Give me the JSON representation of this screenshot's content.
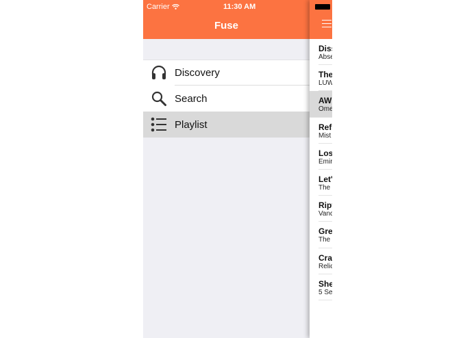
{
  "status_bar": {
    "carrier": "Carrier",
    "time": "11:30 AM"
  },
  "menu": {
    "title": "Fuse",
    "items": [
      {
        "label": "Discovery",
        "icon": "headphones-icon",
        "selected": false
      },
      {
        "label": "Search",
        "icon": "search-icon",
        "selected": false
      },
      {
        "label": "Playlist",
        "icon": "list-icon",
        "selected": true
      }
    ]
  },
  "songs": [
    {
      "title": "Diss",
      "artist": "Abse",
      "selected": false
    },
    {
      "title": "The",
      "artist": "LUW",
      "selected": false
    },
    {
      "title": "AW",
      "artist": "Ome",
      "selected": true
    },
    {
      "title": "Ref",
      "artist": "Mist",
      "selected": false
    },
    {
      "title": "Los",
      "artist": "Emir",
      "selected": false
    },
    {
      "title": "Let'",
      "artist": "The",
      "selected": false
    },
    {
      "title": "Ript",
      "artist": "Vanc",
      "selected": false
    },
    {
      "title": "Gre",
      "artist": "The",
      "selected": false
    },
    {
      "title": "Cra",
      "artist": "Relic",
      "selected": false
    },
    {
      "title": "She",
      "artist": "5 Se",
      "selected": false
    }
  ],
  "colors": {
    "accent": "#fc7341",
    "selected_row": "#d9d9d9",
    "menu_background": "#efeff4"
  }
}
